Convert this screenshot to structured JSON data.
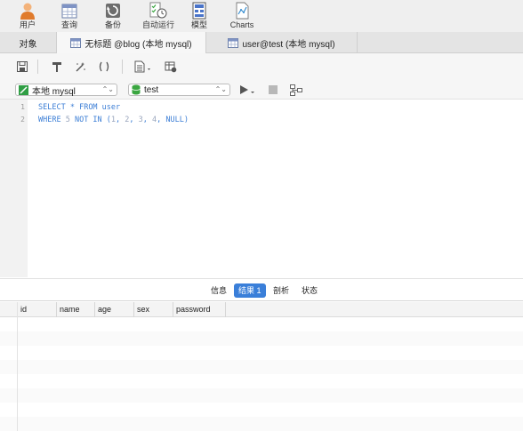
{
  "toolbar": {
    "items": [
      {
        "label": "用户",
        "icon": "user-icon"
      },
      {
        "label": "查询",
        "icon": "query-icon"
      },
      {
        "label": "备份",
        "icon": "backup-icon"
      },
      {
        "label": "自动运行",
        "icon": "automation-icon"
      },
      {
        "label": "模型",
        "icon": "model-icon"
      },
      {
        "label": "Charts",
        "icon": "charts-icon"
      }
    ]
  },
  "tabs": [
    {
      "label": "对象"
    },
    {
      "label": "无标题 @blog (本地 mysql)",
      "active": true
    },
    {
      "label": "user@test (本地 mysql)"
    }
  ],
  "connection": {
    "selected": "本地 mysql"
  },
  "database": {
    "selected": "test"
  },
  "editor": {
    "line_numbers": [
      "1",
      "2"
    ],
    "line1": {
      "select": "SELECT",
      "star": " * ",
      "from": "FROM",
      "table": " user"
    },
    "line2": {
      "where": "WHERE",
      "five": " 5 ",
      "not": "NOT",
      "in": " IN ",
      "open": "(",
      "v1": "1",
      "c1": ", ",
      "v2": "2",
      "c2": ", ",
      "v3": "3",
      "c3": ", ",
      "v4": "4",
      "c4": ", ",
      "null": "NULL",
      "close": ")"
    }
  },
  "result_tabs": [
    {
      "label": "信息"
    },
    {
      "label": "结果 1",
      "active": true
    },
    {
      "label": "剖析"
    },
    {
      "label": "状态"
    }
  ],
  "grid": {
    "columns": [
      "id",
      "name",
      "age",
      "sex",
      "password"
    ]
  },
  "colors": {
    "accent": "#3a7fd9",
    "keyword": "#3d7fd6",
    "number": "#9aa6bd",
    "database_icon": "#3aa640",
    "connection_icon": "#2f9e44"
  }
}
